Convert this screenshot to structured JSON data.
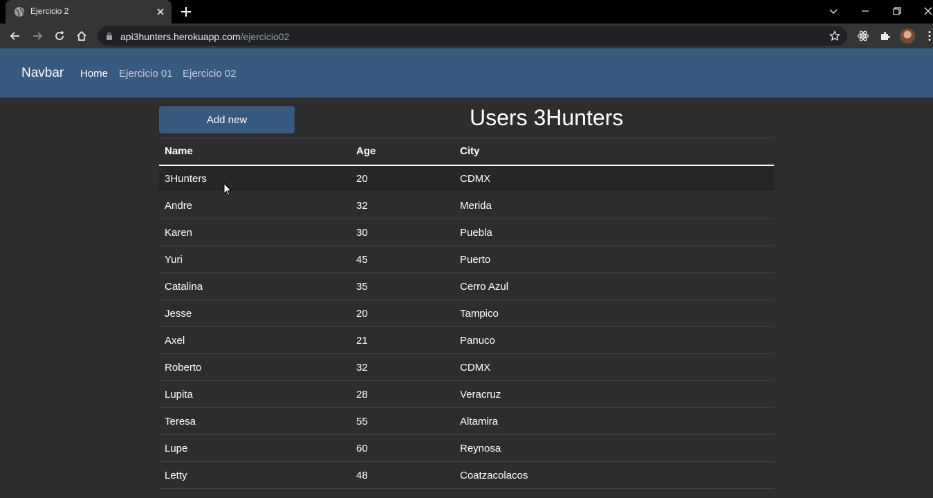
{
  "browser": {
    "tab_title": "Ejercicio 2",
    "url_host": "api3hunters.herokuapp.com",
    "url_path": "/ejercicio02"
  },
  "navbar": {
    "brand": "Navbar",
    "links": [
      {
        "label": "Home",
        "active": true
      },
      {
        "label": "Ejercicio 01",
        "active": false
      },
      {
        "label": "Ejercicio 02",
        "active": false
      }
    ]
  },
  "main": {
    "add_button": "Add new",
    "title": "Users 3Hunters",
    "table": {
      "headers": [
        "Name",
        "Age",
        "City"
      ],
      "rows": [
        [
          "3Hunters",
          "20",
          "CDMX"
        ],
        [
          "Andre",
          "32",
          "Merida"
        ],
        [
          "Karen",
          "30",
          "Puebla"
        ],
        [
          "Yuri",
          "45",
          "Puerto"
        ],
        [
          "Catalina",
          "35",
          "Cerro Azul"
        ],
        [
          "Jesse",
          "20",
          "Tampico"
        ],
        [
          "Axel",
          "21",
          "Panuco"
        ],
        [
          "Roberto",
          "32",
          "CDMX"
        ],
        [
          "Lupita",
          "28",
          "Veracruz"
        ],
        [
          "Teresa",
          "55",
          "Altamira"
        ],
        [
          "Lupe",
          "60",
          "Reynosa"
        ],
        [
          "Letty",
          "48",
          "Coatzacolacos"
        ]
      ]
    }
  },
  "colors": {
    "navbar_bg": "#375a7f",
    "page_bg": "#2d2d2d",
    "button_bg": "#375a7f"
  }
}
